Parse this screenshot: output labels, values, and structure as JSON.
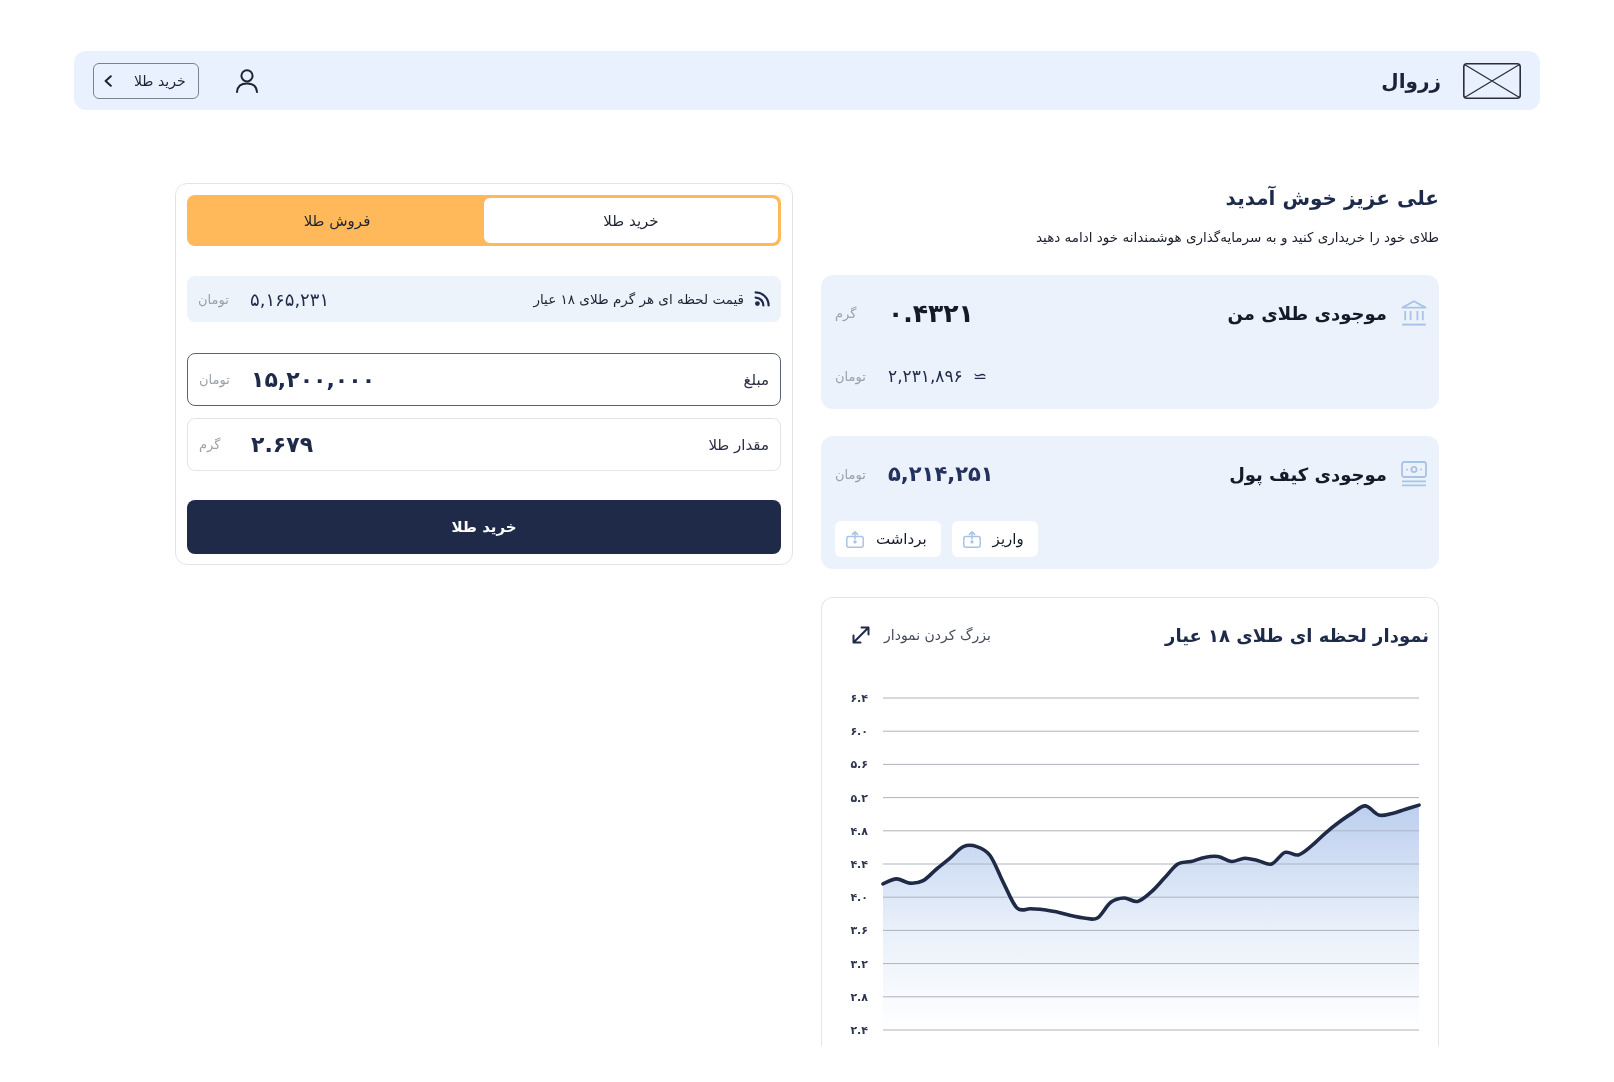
{
  "header": {
    "brand": "زروال",
    "nav_button": "خرید طلا"
  },
  "welcome": {
    "title": "علی عزیز خوش آمدید",
    "subtitle": "طلای خود را خریداری کنید و به سرمایه‌گذاری هوشمندانه خود ادامه دهید"
  },
  "gold_balance": {
    "title": "موجودی طلای من",
    "amount": "۰.۴۳۲۱",
    "unit": "گرم",
    "approx_symbol": "≃",
    "approx_value": "۲,۲۳۱,۸۹۶",
    "approx_unit": "تومان"
  },
  "wallet": {
    "title": "موجودی کیف پول",
    "balance": "۵,۲۱۴,۲۵۱",
    "unit": "تومان",
    "actions": [
      "واریز",
      "برداشت"
    ]
  },
  "price_chart": {
    "expand_link": "بزرگ کردن نمودار",
    "chart_data": {
      "type": "area",
      "title": "نمودار لحظه ای طلای ۱۸ عیار",
      "grid": true,
      "series": [
        {
          "color": "#1f2a47",
          "values": [
            4.16,
            4.22,
            4.17,
            4.2,
            4.34,
            4.47,
            4.61,
            4.61,
            4.5,
            4.17,
            3.87,
            3.86,
            3.85,
            3.82,
            3.78,
            3.75,
            3.75,
            3.94,
            3.99,
            3.95,
            4.06,
            4.23,
            4.4,
            4.43,
            4.48,
            4.49,
            4.43,
            4.47,
            4.44,
            4.4,
            4.54,
            4.51,
            4.62,
            4.77,
            4.9,
            5.01,
            5.1,
            4.99,
            5.01,
            5.06,
            5.11
          ]
        }
      ],
      "ylim": [
        2.4,
        6.4
      ],
      "yticks": [
        {
          "value": 6.4,
          "label": "۶.۴"
        },
        {
          "value": 6.0,
          "label": "۶.۰"
        },
        {
          "value": 5.6,
          "label": "۵.۶"
        },
        {
          "value": 5.2,
          "label": "۵.۲"
        },
        {
          "value": 4.8,
          "label": "۴.۸"
        },
        {
          "value": 4.4,
          "label": "۴.۴"
        },
        {
          "value": 4.0,
          "label": "۴.۰"
        },
        {
          "value": 3.6,
          "label": "۳.۶"
        },
        {
          "value": 3.2,
          "label": "۳.۲"
        },
        {
          "value": 2.8,
          "label": "۲.۸"
        },
        {
          "value": 2.4,
          "label": "۲.۴"
        }
      ]
    }
  },
  "trade_panel": {
    "tabs": [
      {
        "label": "خرید طلا",
        "selected": true
      },
      {
        "label": "فروش طلا",
        "selected": false
      }
    ],
    "price": {
      "label": "قیمت لحظه ای هر گرم طلای ۱۸ عیار",
      "value": "۵,۱۶۵,۲۳۱",
      "unit": "تومان"
    },
    "fields": [
      {
        "label": "مبلغ",
        "value": "۱۵,۲۰۰,۰۰۰",
        "unit": "تومان",
        "focused": true
      },
      {
        "label": "مقدار طلا",
        "value": "۲.۶۷۹",
        "unit": "گرم",
        "focused": false
      }
    ],
    "submit_button": "خرید طلا"
  }
}
